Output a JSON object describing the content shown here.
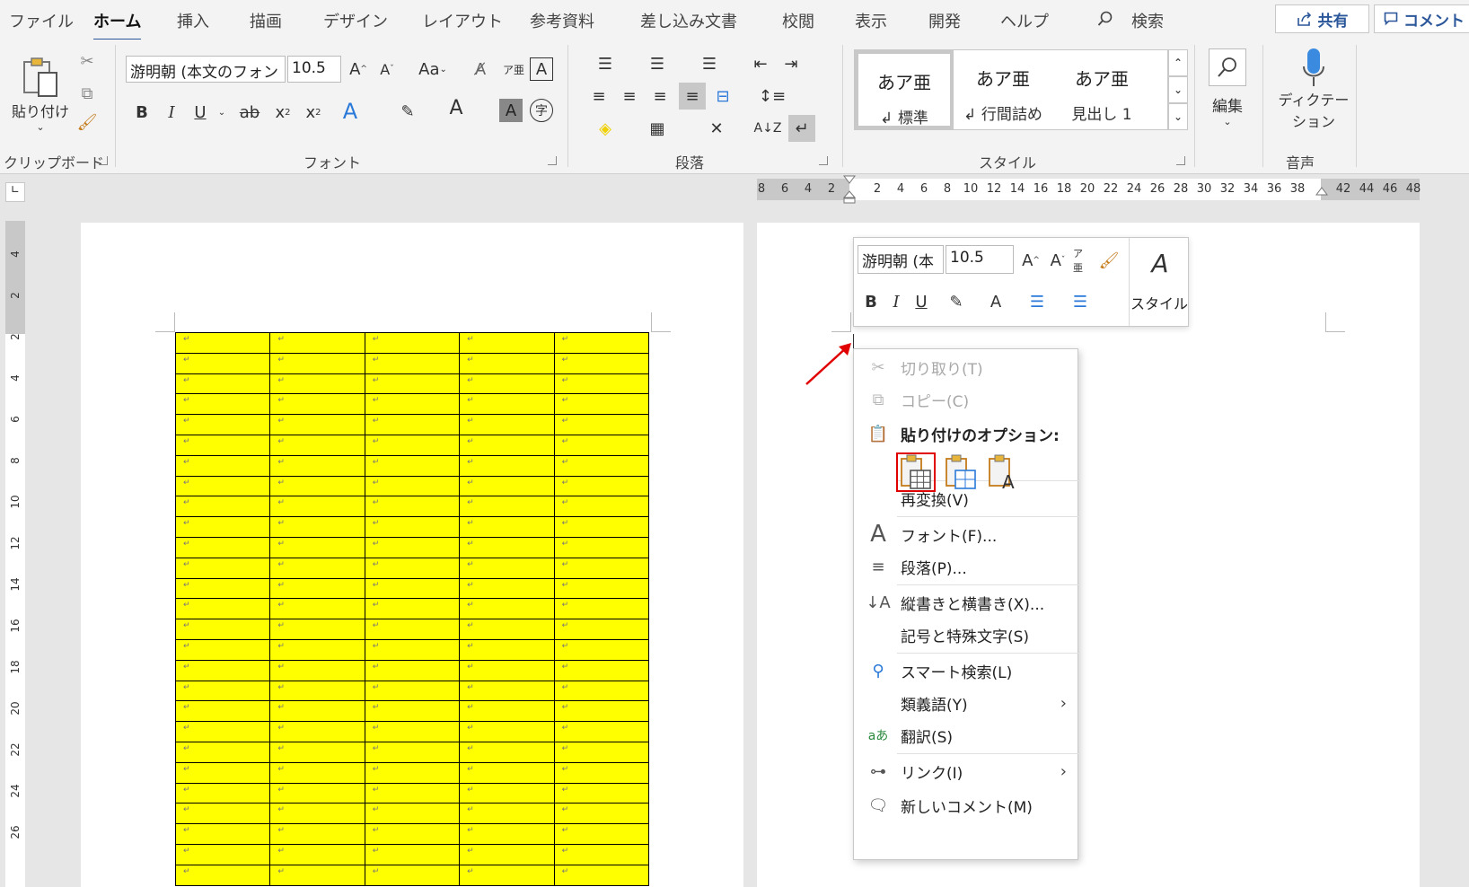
{
  "tabs": [
    "ファイル",
    "ホーム",
    "挿入",
    "描画",
    "デザイン",
    "レイアウト",
    "参考資料",
    "差し込み文書",
    "校閲",
    "表示",
    "開発",
    "ヘルプ"
  ],
  "active_tab": "ホーム",
  "search_label": "検索",
  "share_label": "共有",
  "comment_label": "コメント",
  "ribbon": {
    "clipboard": {
      "paste_label": "貼り付け",
      "group_label": "クリップボード"
    },
    "font": {
      "group_label": "フォント",
      "font_name": "游明朝 (本文のフォン",
      "font_size": "10.5",
      "change_case": "Aa",
      "bold": "B",
      "italic": "I",
      "underline": "U",
      "strike": "ab"
    },
    "paragraph": {
      "group_label": "段落"
    },
    "styles": {
      "group_label": "スタイル",
      "items": [
        {
          "sample": "あア亜",
          "name": "↲ 標準"
        },
        {
          "sample": "あア亜",
          "name": "↲ 行間詰め"
        },
        {
          "sample": "あア亜",
          "name": "見出し 1"
        }
      ]
    },
    "editing": {
      "label": "編集"
    },
    "voice": {
      "dictate_label_1": "ディクテー",
      "dictate_label_2": "ション",
      "group_label": "音声"
    }
  },
  "ruler": {
    "h_numbers": [
      "8",
      "6",
      "4",
      "2",
      "2",
      "4",
      "6",
      "8",
      "10",
      "12",
      "14",
      "16",
      "18",
      "20",
      "22",
      "24",
      "26",
      "28",
      "30",
      "32",
      "34",
      "36",
      "38",
      "42",
      "44",
      "46",
      "48"
    ],
    "v_numbers": [
      "4",
      "2",
      "2",
      "4",
      "6",
      "8",
      "10",
      "12",
      "14",
      "16",
      "18",
      "20",
      "22",
      "24",
      "26"
    ]
  },
  "mini_toolbar": {
    "font_name": "游明朝 (本",
    "font_size": "10.5",
    "bold": "B",
    "italic": "I",
    "underline": "U",
    "styles_label": "スタイル"
  },
  "context_menu": {
    "cut": "切り取り(T)",
    "copy": "コピー(C)",
    "paste_options": "貼り付けのオプション:",
    "reconvert": "再変換(V)",
    "font": "フォント(F)...",
    "paragraph": "段落(P)...",
    "text_direction": "縦書きと横書き(X)...",
    "symbols": "記号と特殊文字(S)",
    "smart_lookup": "スマート検索(L)",
    "synonyms": "類義語(Y)",
    "translate": "翻訳(S)",
    "link": "リンク(I)",
    "new_comment": "新しいコメント(M)"
  },
  "table": {
    "rows": 27,
    "cols": 5,
    "fill_color": "#ffff00",
    "cell_mark": "↵"
  },
  "colors": {
    "accent": "#2b579a",
    "highlight_box": "#e00000",
    "arrow": "#e00000"
  }
}
